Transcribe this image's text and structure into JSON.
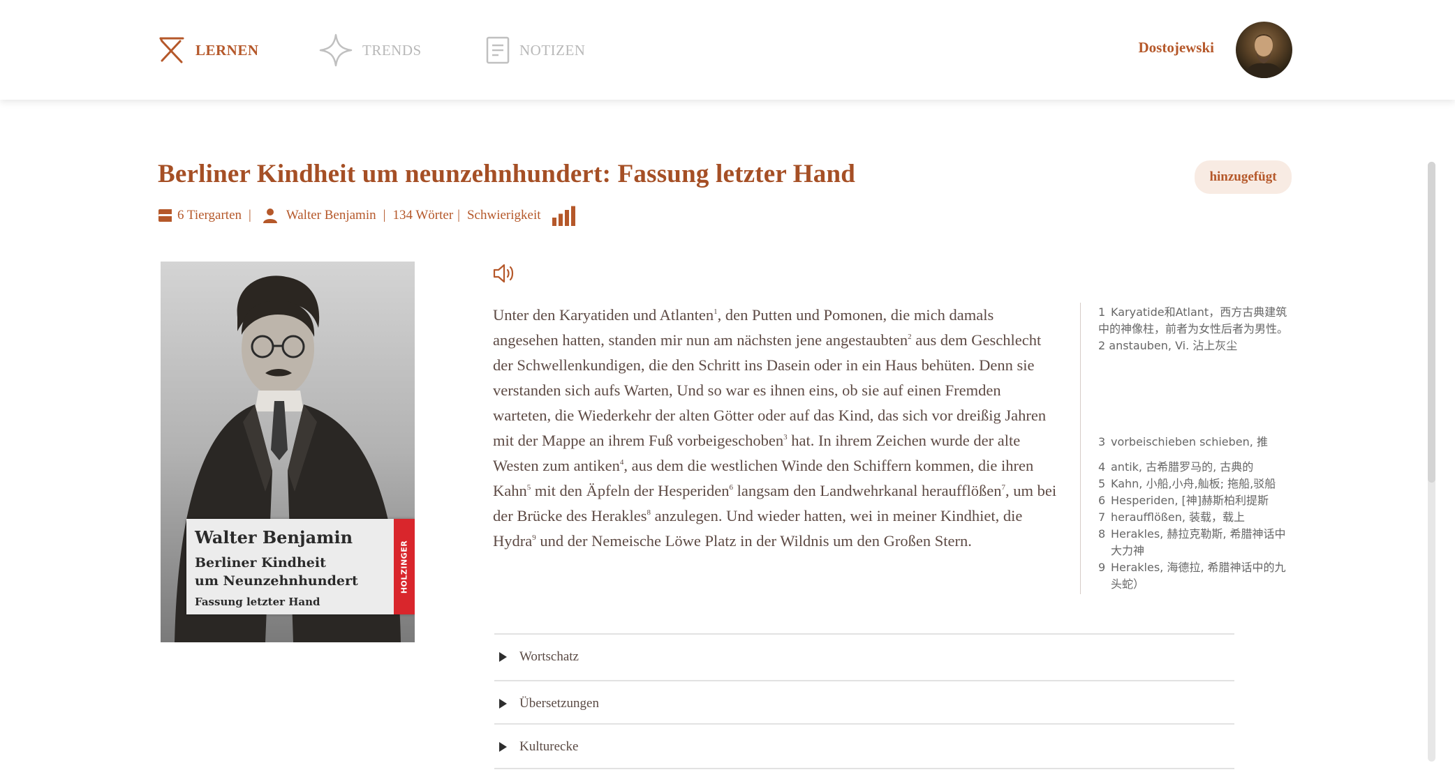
{
  "nav": {
    "items": [
      {
        "label": "LERNEN",
        "icon": "learn-icon",
        "active": true
      },
      {
        "label": "TRENDS",
        "icon": "sparkle-icon",
        "active": false
      },
      {
        "label": "NOTIZEN",
        "icon": "notes-icon",
        "active": false
      }
    ],
    "user_name": "Dostojewski"
  },
  "article": {
    "title": "Berliner Kindheit um neunzehnhundert: Fassung letzter Hand",
    "status_badge": "hinzugefügt",
    "meta": {
      "chapter": "6 Tiergarten",
      "author": "Walter Benjamin",
      "word_count": "134 Wörter",
      "difficulty_label": "Schwierigkeit",
      "difficulty_level": 4,
      "difficulty_max": 4
    }
  },
  "cover": {
    "author": "Walter Benjamin",
    "title_line1": "Berliner Kindheit",
    "title_line2": "um Neunzehnhundert",
    "subtitle": "Fassung letzter Hand",
    "publisher": "HOLZINGER"
  },
  "text": {
    "segments": [
      {
        "t": "Unter den Karyatiden und Atlanten",
        "sup": "1"
      },
      {
        "t": ", den Putten und Pomonen, die mich damals angesehen hatten, standen mir nun am nächsten jene angestaubten",
        "sup": "2"
      },
      {
        "t": " aus dem Geschlecht der Schwellenkundigen,  die den Schritt ins Dasein oder in ein Haus behüten. Denn sie verstanden sich aufs Warten, Und so war es ihnen eins, ob sie auf einen Fremden warteten, die Wiederkehr der alten Götter oder auf das Kind, das sich vor dreißig Jahren mit der Mappe an ihrem Fuß vorbeigeschoben",
        "sup": "3"
      },
      {
        "t": " hat. In ihrem Zeichen wurde der alte Westen zum antiken",
        "sup": "4"
      },
      {
        "t": ", aus dem die westlichen Winde den Schiffern kommen, die ihren Kahn",
        "sup": "5"
      },
      {
        "t": " mit den Äpfeln der Hesperiden",
        "sup": "6"
      },
      {
        "t": " langsam den Landwehrkanal heraufflößen",
        "sup": "7"
      },
      {
        "t": ", um bei der Brücke des Herakles",
        "sup": "8"
      },
      {
        "t": " anzulegen. Und wieder hatten, wei in meiner Kindhiet, die  Hydra",
        "sup": "9"
      },
      {
        "t": " und der Nemeische Löwe Platz in der Wildnis um den Großen Stern.",
        "sup": ""
      }
    ]
  },
  "footnotes": [
    {
      "num": "1",
      "text": "Karyatide和Atlant，西方古典建筑中的神像柱，前者为女性后者为男性。 2  anstauben,  Vi. 沾上灰尘"
    },
    {
      "num": "3",
      "text": "vorbeischieben  schieben, 推"
    },
    {
      "num": "4",
      "text": "antik, 古希腊罗马的, 古典的"
    },
    {
      "num": "5",
      "text": "Kahn, 小船,小舟,舢板; 拖船,驳船"
    },
    {
      "num": "6",
      "text": "Hesperiden, [神]赫斯柏利提斯"
    },
    {
      "num": "7",
      "text": "heraufflößen, 装载，载上"
    },
    {
      "num": "8",
      "text": "Herakles,  赫拉克勒斯, 希腊神话中大力神"
    },
    {
      "num": "9",
      "text": "Herakles,  海德拉, 希腊神话中的九头蛇）"
    }
  ],
  "sections": [
    {
      "label": "Wortschatz"
    },
    {
      "label": "Übersetzungen"
    },
    {
      "label": "Kulturecke"
    }
  ],
  "colors": {
    "accent": "#b5582a",
    "title": "#a54f25",
    "badge_bg": "#f8ebe3",
    "body_text": "#5d4a44",
    "inactive_nav": "#b8b8b8"
  }
}
